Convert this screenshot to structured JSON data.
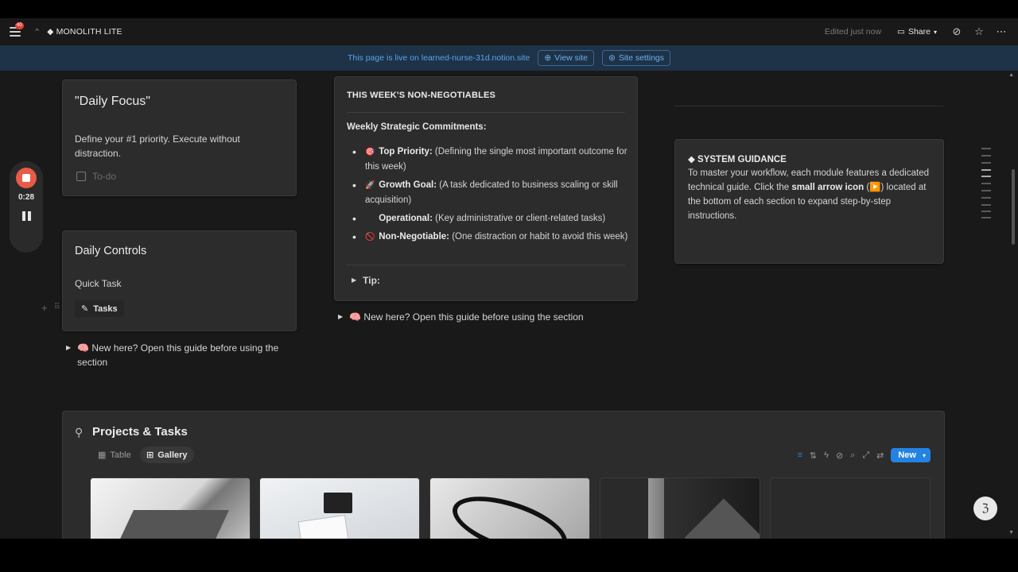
{
  "topbar": {
    "breadcrumb": "◆ MONOLITH LITE",
    "notif_count": "40",
    "edited": "Edited just now",
    "share_label": "Share"
  },
  "banner": {
    "text": "This page is live on learned-nurse-31d.notion.site",
    "view_site": "View site",
    "site_settings": "Site settings"
  },
  "recorder": {
    "time": "0:28"
  },
  "daily_focus": {
    "title": "\"Daily Focus\"",
    "description": "Define your #1 priority. Execute without distraction.",
    "todo_placeholder": "To-do"
  },
  "daily_controls": {
    "title": "Daily Controls",
    "quick_task": "Quick Task",
    "tasks_button": "Tasks"
  },
  "left_guide": "🧠 New here? Open this guide before using the section",
  "weekly": {
    "title": "THIS WEEK'S NON-NEGOTIABLES",
    "subtitle": "Weekly Strategic Commitments:",
    "items": [
      {
        "emoji": "🎯",
        "label": "Top Priority:",
        "text": " (Defining the single most important outcome for this week)"
      },
      {
        "emoji": "🚀",
        "label": "Growth Goal:",
        "text": " (A task dedicated to business scaling or skill acquisition)"
      },
      {
        "emoji": "",
        "label": "Operational:",
        "text": " (Key administrative or client-related tasks)"
      },
      {
        "emoji": "🚫",
        "label": "Non-Negotiable:",
        "text": " (One distraction or habit to avoid this week)"
      }
    ],
    "tip": "Tip:"
  },
  "middle_guide": "🧠 New here? Open this guide before using the section",
  "guidance": {
    "title": "◆ SYSTEM GUIDANCE",
    "text_a": "To master your workflow, each module features a dedicated technical guide. Click the ",
    "text_bold": "small arrow icon",
    "text_b": " (▶️) located at the bottom of each section to expand step-by-step instructions."
  },
  "projects": {
    "title": "Projects & Tasks",
    "views": [
      "Table",
      "Gallery"
    ],
    "new_label": "New"
  },
  "colors": {
    "accent": "#2383e2",
    "banner_bg": "#1e3248",
    "record": "#e85b47"
  }
}
